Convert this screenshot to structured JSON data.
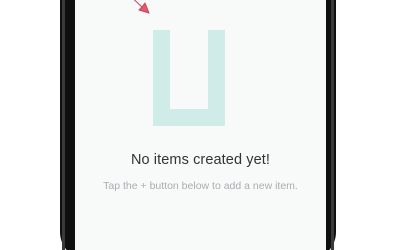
{
  "empty_state": {
    "icon": "empty-box-icon",
    "title": "No items created yet!",
    "subtitle": "Tap the + button below to add a new item."
  },
  "annotation": {
    "icon": "red-arrow-pointer-icon"
  },
  "colors": {
    "screen_background": "#f8f9f9",
    "icon_color": "#d0ece9",
    "title_color": "#333333",
    "subtitle_color": "#a8aeb1",
    "arrow_color": "#e35a6a",
    "phone_frame": "#0f0f10"
  }
}
